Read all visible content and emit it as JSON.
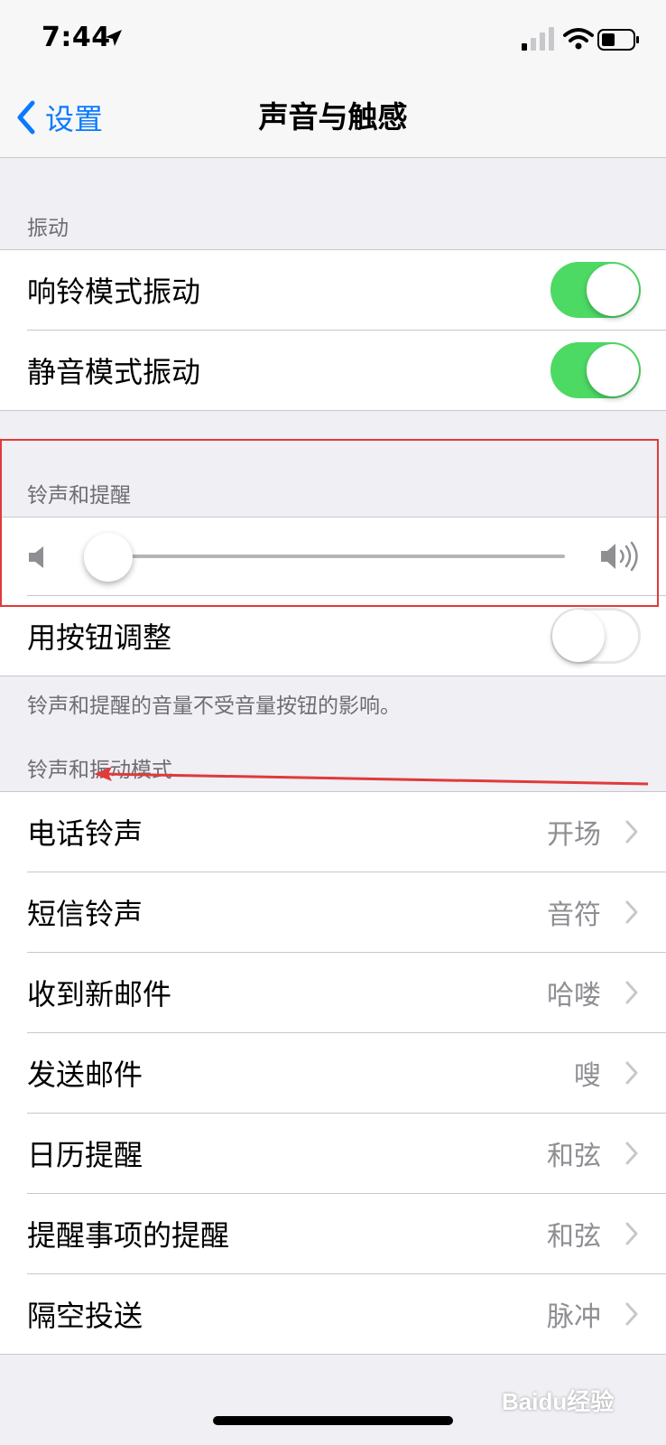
{
  "status_bar": {
    "time": "7:44"
  },
  "nav": {
    "back_label": "设置",
    "title": "声音与触感"
  },
  "vibration": {
    "header": "振动",
    "items": [
      {
        "label": "响铃模式振动",
        "on": true
      },
      {
        "label": "静音模式振动",
        "on": true
      }
    ]
  },
  "ringer": {
    "header": "铃声和提醒",
    "volume_level": 0.0,
    "adjust_with_buttons": {
      "label": "用按钮调整",
      "on": false
    },
    "footer": "铃声和提醒的音量不受音量按钮的影响。"
  },
  "patterns": {
    "header": "铃声和振动模式",
    "items": [
      {
        "label": "电话铃声",
        "value": "开场"
      },
      {
        "label": "短信铃声",
        "value": "音符"
      },
      {
        "label": "收到新邮件",
        "value": "哈喽"
      },
      {
        "label": "发送邮件",
        "value": "嗖"
      },
      {
        "label": "日历提醒",
        "value": "和弦"
      },
      {
        "label": "提醒事项的提醒",
        "value": "和弦"
      },
      {
        "label": "隔空投送",
        "value": "脉冲"
      }
    ]
  },
  "watermark": "Baidu经验",
  "colors": {
    "accent": "#0a7aff",
    "toggle_on": "#4cd964",
    "annotation": "#e03a3a"
  },
  "icons": [
    "location-arrow-icon",
    "cellular-signal-icon",
    "wifi-icon",
    "battery-icon",
    "back-chevron-icon",
    "volume-low-icon",
    "volume-high-icon",
    "chevron-right-icon"
  ]
}
